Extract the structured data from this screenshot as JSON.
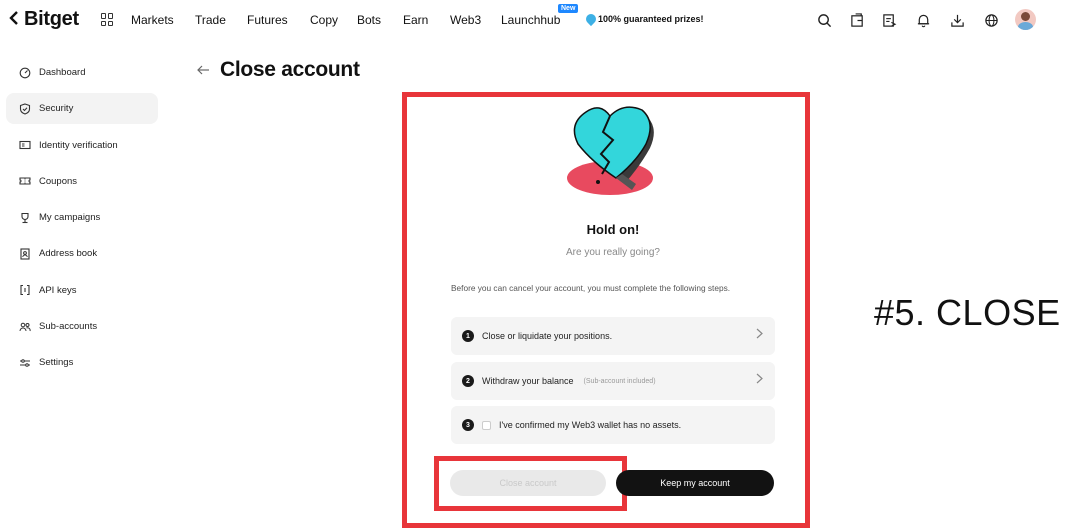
{
  "nav": {
    "logo": "Bitget",
    "items": [
      "Markets",
      "Trade",
      "Futures",
      "Copy",
      "Bots",
      "Earn",
      "Web3",
      "Launchhub"
    ],
    "new_badge": "New",
    "promo": "100% guaranteed prizes!"
  },
  "sidebar": {
    "items": [
      {
        "label": "Dashboard",
        "icon": "dashboard-icon"
      },
      {
        "label": "Security",
        "icon": "shield-icon",
        "active": true
      },
      {
        "label": "Identity verification",
        "icon": "id-card-icon"
      },
      {
        "label": "Coupons",
        "icon": "coupon-icon"
      },
      {
        "label": "My campaigns",
        "icon": "trophy-icon"
      },
      {
        "label": "Address book",
        "icon": "address-book-icon"
      },
      {
        "label": "API keys",
        "icon": "api-icon"
      },
      {
        "label": "Sub-accounts",
        "icon": "users-icon"
      },
      {
        "label": "Settings",
        "icon": "sliders-icon"
      }
    ]
  },
  "page": {
    "title": "Close account"
  },
  "dialog": {
    "title": "Hold on!",
    "subtitle": "Are you really going?",
    "intro": "Before you can cancel your account, you must complete the following steps.",
    "steps": [
      {
        "num": "1",
        "label": "Close or liquidate your positions.",
        "note": ""
      },
      {
        "num": "2",
        "label": "Withdraw your balance",
        "note": "(Sub-account included)"
      },
      {
        "num": "3",
        "label": "I've confirmed my Web3 wallet has no assets.",
        "note": ""
      }
    ],
    "close_button": "Close account",
    "keep_button": "Keep my account"
  },
  "annotation": "#5. CLOSE",
  "colors": {
    "highlight": "#e8353a",
    "heart": "#33d6db",
    "shadow": "#e84a5f",
    "primary_button": "#121212"
  }
}
